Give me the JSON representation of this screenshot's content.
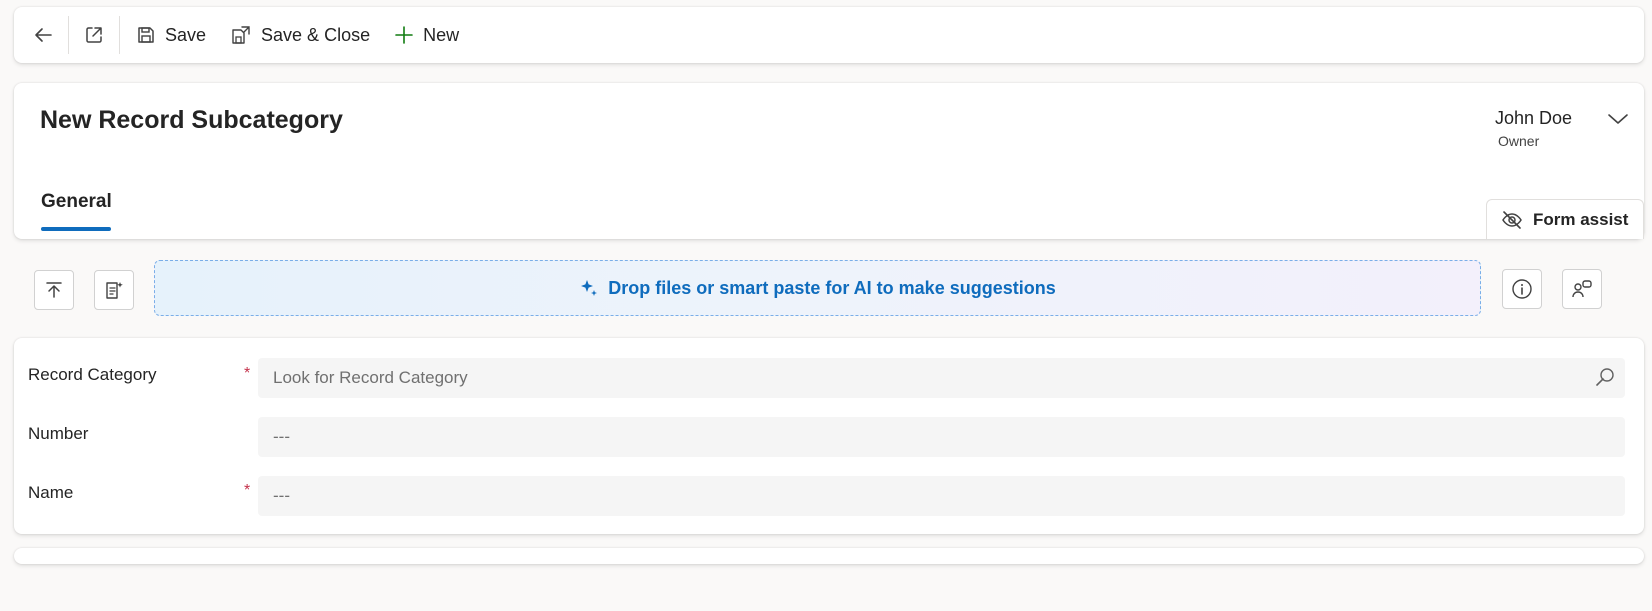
{
  "toolbar": {
    "back_icon": "arrow-left-icon",
    "popout_icon": "open-in-new-window-icon",
    "save_label": "Save",
    "save_close_label": "Save & Close",
    "new_label": "New"
  },
  "header": {
    "title": "New Record Subcategory",
    "owner_name": "John Doe",
    "owner_label": "Owner",
    "tabs": [
      {
        "label": "General",
        "active": true
      }
    ],
    "form_assist_label": "Form assist"
  },
  "ai_bar": {
    "drop_text": "Drop files or smart paste for AI to make suggestions"
  },
  "form": {
    "fields": [
      {
        "label": "Record Category",
        "required": true,
        "placeholder": "Look for Record Category"
      },
      {
        "label": "Number",
        "required": false,
        "placeholder": "---"
      },
      {
        "label": "Name",
        "required": true,
        "placeholder": "---"
      }
    ]
  },
  "colors": {
    "accent": "#0f6cbd",
    "required": "#c4314b",
    "new_plus": "#107c10"
  }
}
